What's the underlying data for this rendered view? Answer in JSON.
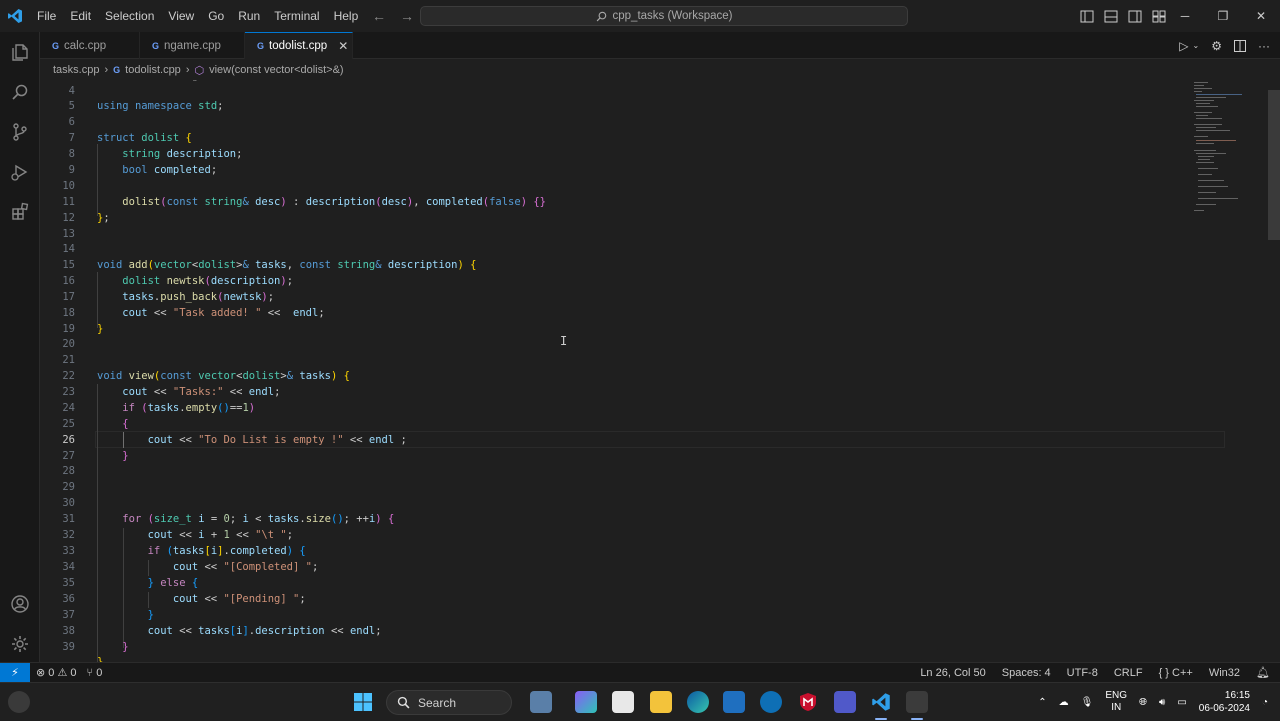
{
  "menu": [
    "File",
    "Edit",
    "Selection",
    "View",
    "Go",
    "Run",
    "Terminal",
    "Help"
  ],
  "command_center": "cpp_tasks (Workspace)",
  "tabs": [
    {
      "label": "calc.cpp",
      "active": false
    },
    {
      "label": "ngame.cpp",
      "active": false
    },
    {
      "label": "todolist.cpp",
      "active": true
    }
  ],
  "breadcrumbs": [
    "tasks.cpp",
    "todolist.cpp",
    "view(const vector<dolist>&)"
  ],
  "editor": {
    "line_numbers": [
      "4",
      "5",
      "6",
      "7",
      "8",
      "9",
      "10",
      "11",
      "12",
      "13",
      "14",
      "15",
      "16",
      "17",
      "18",
      "19",
      "20",
      "21",
      "22",
      "23",
      "24",
      "25",
      "26",
      "27",
      "28",
      "29",
      "30",
      "31",
      "32",
      "33",
      "34",
      "35",
      "36",
      "37",
      "38",
      "39"
    ],
    "current_line": "26"
  },
  "status": {
    "errors": "0",
    "warnings": "0",
    "ports": "0",
    "position": "Ln 26, Col 50",
    "spaces": "Spaces: 4",
    "encoding": "UTF-8",
    "eol": "CRLF",
    "language": "C++",
    "platform": "Win32"
  },
  "taskbar": {
    "search_label": "Search",
    "lang_top": "ENG",
    "lang_bottom": "IN",
    "time": "16:15",
    "date": "06-06-2024"
  },
  "colors": {
    "accent": "#0078d4",
    "background": "#1f1f1f"
  }
}
